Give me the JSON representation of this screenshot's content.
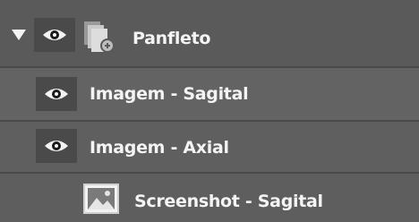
{
  "layers": [
    {
      "label": "Panfleto",
      "icon": "folder-document-icon",
      "visibility_icon": "eye-icon",
      "expanded": true
    },
    {
      "label": "Imagem - Sagital",
      "visibility_icon": "eye-icon"
    },
    {
      "label": "Imagem - Axial",
      "visibility_icon": "eye-icon"
    },
    {
      "label": "Screenshot - Sagital",
      "icon": "image-icon"
    }
  ]
}
